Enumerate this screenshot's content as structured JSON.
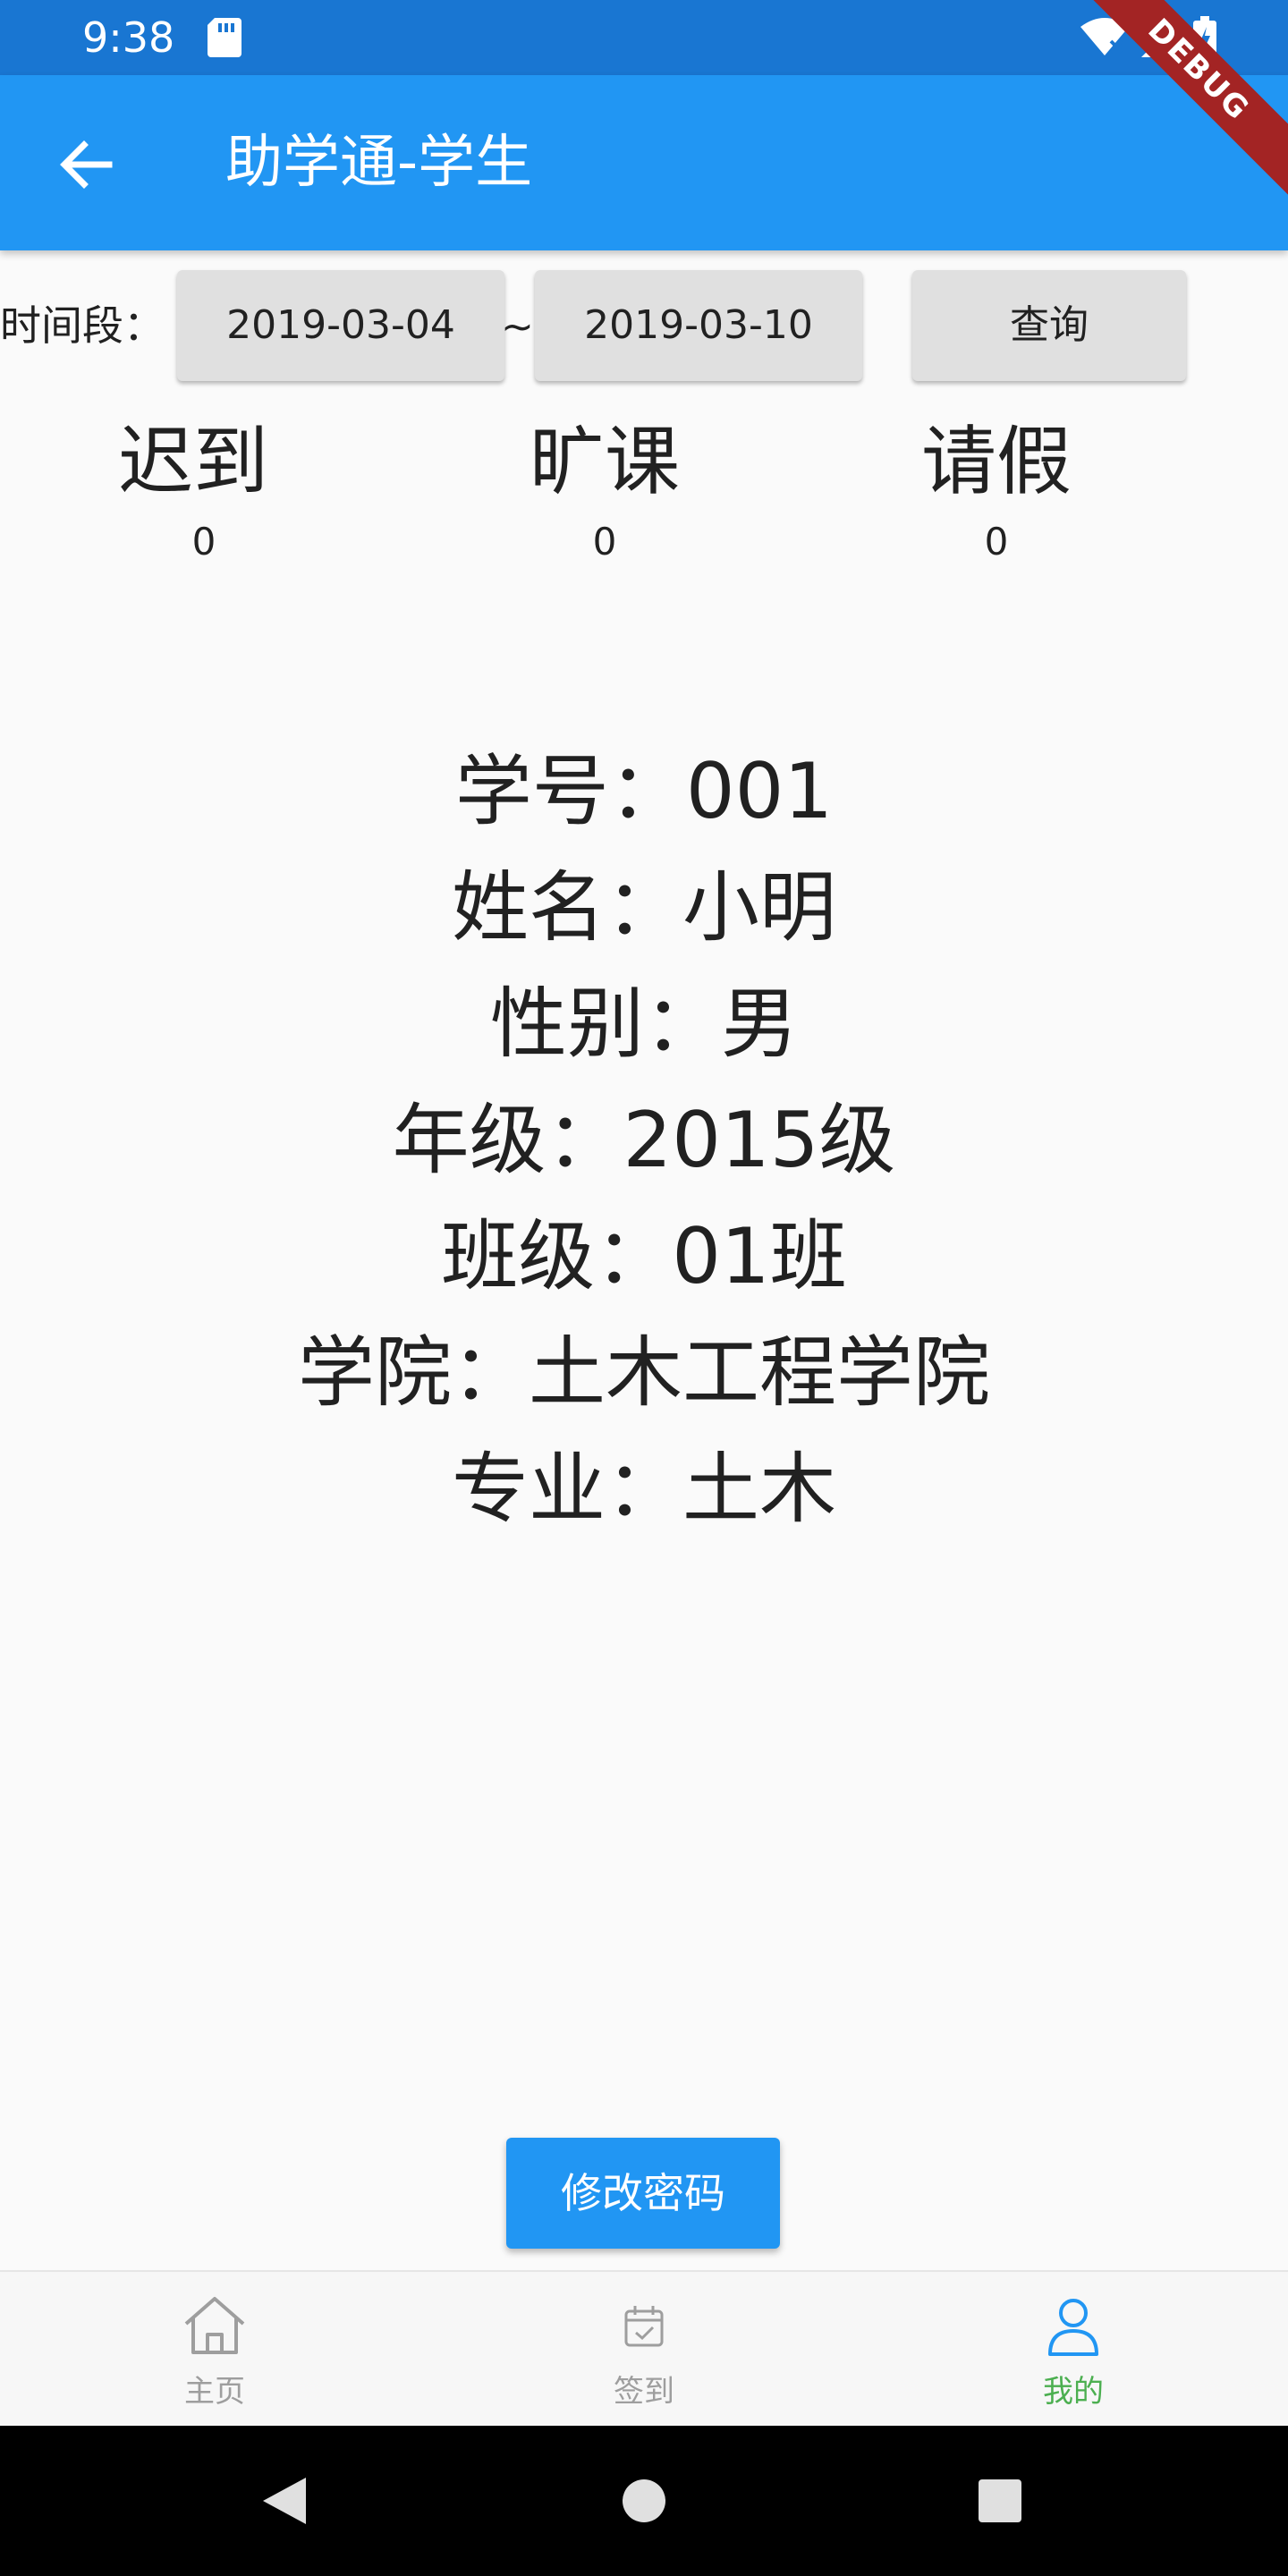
{
  "status_bar": {
    "time": "9:38"
  },
  "app_bar": {
    "title": "助学通-学生"
  },
  "debug_banner": "DEBUG",
  "query": {
    "label": "时间段：",
    "start_date": "2019-03-04",
    "separator": "~",
    "end_date": "2019-03-10",
    "button": "查询"
  },
  "stats": [
    {
      "label": "迟到",
      "value": "0"
    },
    {
      "label": "旷课",
      "value": "0"
    },
    {
      "label": "请假",
      "value": "0"
    }
  ],
  "info": [
    "学号：001",
    "姓名：小明",
    "性别：男",
    "年级：2015级",
    "班级：01班",
    "学院：土木工程学院",
    "专业：土木"
  ],
  "change_password_button": "修改密码",
  "bottom_nav": {
    "items": [
      {
        "label": "主页",
        "icon": "home-icon",
        "active": false
      },
      {
        "label": "签到",
        "icon": "calendar-check-icon",
        "active": false
      },
      {
        "label": "我的",
        "icon": "person-icon",
        "active": true
      }
    ]
  },
  "colors": {
    "app_bar": "#2196f3",
    "status_bar": "#1976d2",
    "nav_active": "#4caf50",
    "nav_inactive": "#9e9e9e"
  }
}
